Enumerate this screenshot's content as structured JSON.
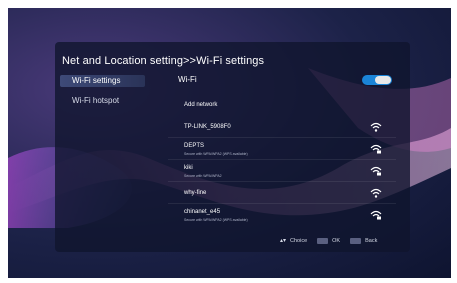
{
  "header": {
    "title": "Net and Location setting>>Wi-Fi settings"
  },
  "sidebar": {
    "items": [
      {
        "label": "Wi-Fi settings"
      },
      {
        "label": "Wi-Fi hotspot"
      }
    ]
  },
  "wifi": {
    "label": "Wi-Fi",
    "enabled": true,
    "add_network": "Add network",
    "networks": [
      {
        "ssid": "TP-LINK_5908F0",
        "detail": ""
      },
      {
        "ssid": "DEPTS",
        "detail": "Secure with WPA/WPA2 (WPS available)"
      },
      {
        "ssid": "kiki",
        "detail": "Secure with WPA/WPA2"
      },
      {
        "ssid": "why-fine",
        "detail": ""
      },
      {
        "ssid": "chinanet_e45",
        "detail": "Secure with WPA/WPA2 (WPS available)"
      }
    ]
  },
  "footer": {
    "choice": "Choice",
    "ok": "OK",
    "back": "Back"
  },
  "colors": {
    "toggle_on": "#1b85d8"
  },
  "icons": [
    "wifi-icon",
    "up-down-icon",
    "ok-key-icon",
    "back-key-icon"
  ]
}
